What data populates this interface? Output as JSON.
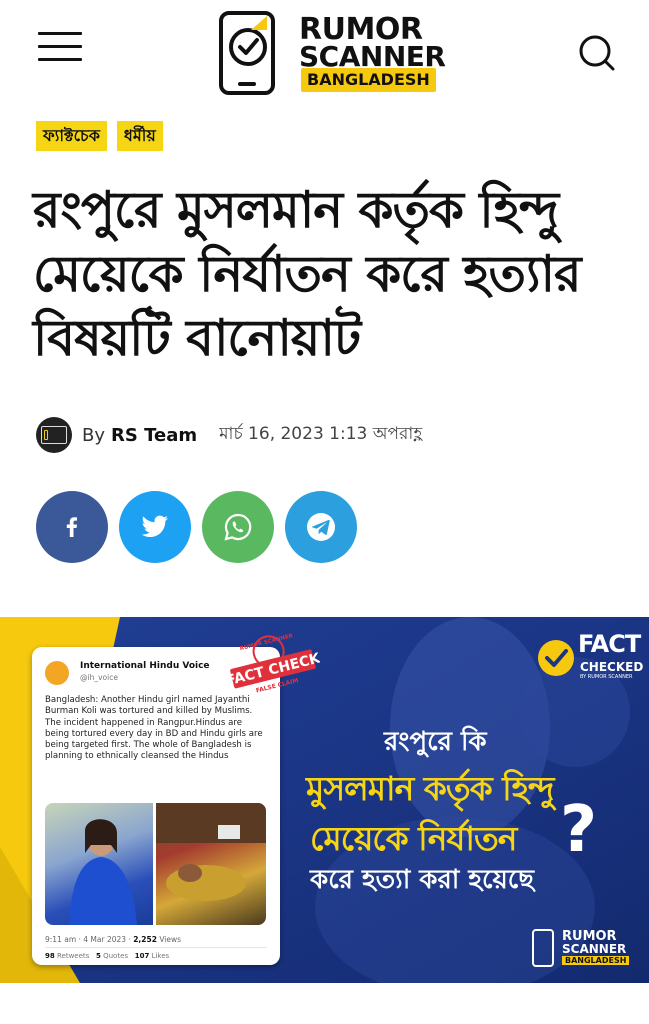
{
  "header": {
    "logo": {
      "line1": "RUMOR",
      "line2": "SCANNER",
      "tag": "BANGLADESH"
    },
    "menu_icon": "hamburger-menu-icon",
    "search_icon": "search-icon"
  },
  "tags": [
    "ফ্যাক্টচেক",
    "ধর্মীয়"
  ],
  "article": {
    "title": "রংপুরে মুসলমান কর্তৃক হিন্দু মেয়েকে নির্যাতন করে হত্যার বিষয়টি বানোয়াট",
    "by_label": "By",
    "author": "RS Team",
    "date": "মার্চ 16, 2023 1:13 অপরাহ্ণ"
  },
  "share": [
    {
      "name": "facebook",
      "icon": "facebook-icon",
      "color": "#3b5998"
    },
    {
      "name": "twitter",
      "icon": "twitter-icon",
      "color": "#1da1f2"
    },
    {
      "name": "whatsapp",
      "icon": "whatsapp-icon",
      "color": "#5ab960"
    },
    {
      "name": "telegram",
      "icon": "telegram-icon",
      "color": "#2c9fde"
    }
  ],
  "featured_image": {
    "tweet": {
      "name": "International Hindu Voice",
      "handle": "@ih_voice",
      "text": "Bangladesh: Another Hindu girl named Jayanthi Burman Koli was tortured and killed by Muslims. The incident happened in Rangpur.Hindus are being tortured every day in BD and Hindu girls are being targeted first. The whole of Bangladesh is planning to ethnically cleansed the Hindus",
      "time": "9:11 am · 4 Mar 2023 · ",
      "views_count": "2,252",
      "views_label": " Views",
      "retweets_count": "98",
      "retweets_label": " Retweets",
      "quotes_count": "5",
      "quotes_label": " Quotes",
      "likes_count": "107",
      "likes_label": " Likes"
    },
    "stamp": {
      "top": "RUMOR SCANNER",
      "main": "FACT CHECK",
      "sub": "FALSE CLAIM"
    },
    "badge": {
      "line1": "FACT",
      "line2": "CHECKED",
      "line3": "BY RUMOR SCANNER"
    },
    "question": {
      "line1": "রংপুরে কি",
      "line2": "মুসলমান কর্তৃক হিন্দু",
      "line3": "মেয়েকে নির্যাতন",
      "line4": "করে হত্যা করা হয়েছে",
      "mark": "?"
    },
    "logo": {
      "line1": "RUMOR",
      "line2": "SCANNER",
      "line3": "BANGLADESH"
    },
    "colors": {
      "background": "#1d3a8a",
      "accent": "#f6d515"
    }
  }
}
